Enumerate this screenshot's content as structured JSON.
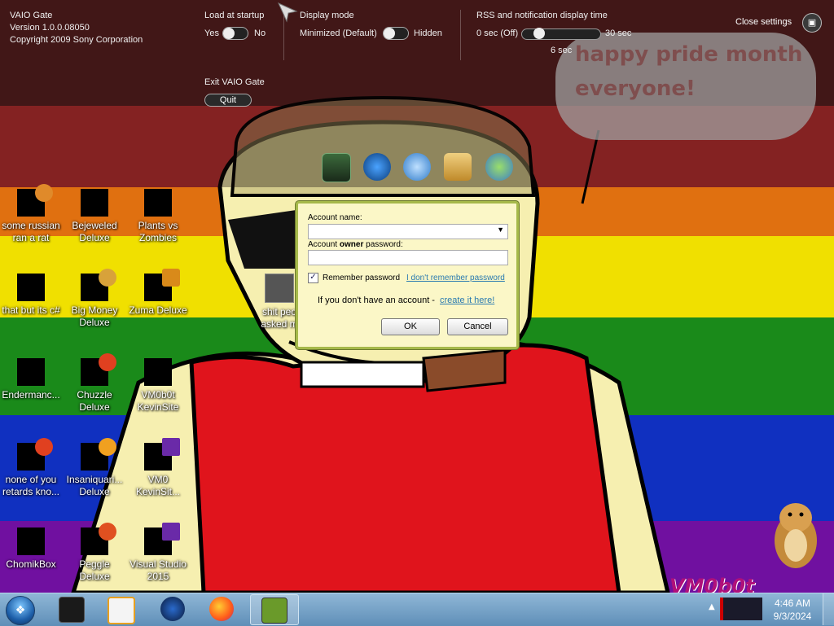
{
  "vaio_gate": {
    "app_name": "VAIO Gate",
    "version": "Version 1.0.0.08050",
    "copyright": "Copyright 2009 Sony Corporation",
    "load_at_startup": {
      "label": "Load at startup",
      "on_label": "Yes",
      "off_label": "No"
    },
    "display_mode": {
      "label": "Display mode",
      "left_label": "Minimized (Default)",
      "right_label": "Hidden"
    },
    "rss": {
      "label": "RSS and notification display time",
      "min_label": "0 sec (Off)",
      "max_label": "30 sec",
      "current_label": "6 sec",
      "value_sec": 6,
      "max_sec": 30
    },
    "exit": {
      "label": "Exit VAIO Gate",
      "button": "Quit"
    },
    "close_settings": "Close settings"
  },
  "wallpaper": {
    "bubble_line1": "happy pride month",
    "bubble_line2": "everyone!",
    "stripe_colors": [
      "#c03030",
      "#e07010",
      "#f0e000",
      "#1a8a1a",
      "#1030c0",
      "#7010a0"
    ]
  },
  "dialog": {
    "account_name_label": "Account name:",
    "password_label_pre": "Account ",
    "password_label_bold": "owner",
    "password_label_post": " password:",
    "remember_label": "Remember password",
    "remember_checked": true,
    "forgot_link": "I don't remember password",
    "no_account_text": "If you don't have an account - ",
    "create_link": "create it here!",
    "ok": "OK",
    "cancel": "Cancel"
  },
  "desktop_icons": [
    {
      "label1": "some russian",
      "label2": "ran a rat"
    },
    {
      "label1": "Bejeweled",
      "label2": "Deluxe"
    },
    {
      "label1": "Plants vs",
      "label2": "Zombies"
    },
    {
      "label1": "that but its c#",
      "label2": ""
    },
    {
      "label1": "Big Money",
      "label2": "Deluxe"
    },
    {
      "label1": "Zuma Deluxe",
      "label2": ""
    },
    {
      "label1": "Endermanc...",
      "label2": ""
    },
    {
      "label1": "Chuzzle",
      "label2": "Deluxe"
    },
    {
      "label1": "VM0b0t",
      "label2": "KevinSite"
    },
    {
      "label1": "none of you",
      "label2": "retards kno..."
    },
    {
      "label1": "Insaniquari...",
      "label2": "Deluxe"
    },
    {
      "label1": "VM0",
      "label2": "KevinSit..."
    },
    {
      "label1": "ChomikBox",
      "label2": ""
    },
    {
      "label1": "Peggle Deluxe",
      "label2": ""
    },
    {
      "label1": "Visual Studio",
      "label2": "2015"
    },
    {
      "label1": "shit peo",
      "label2": "asked m"
    }
  ],
  "taskbar": {
    "items": [
      "terminal-icon",
      "media-player-icon",
      "network-icon",
      "firefox-icon",
      "chomikbox-icon"
    ],
    "clock_time": "4:46 AM",
    "clock_date": "9/3/2024"
  },
  "watermark": "VM0b0t"
}
